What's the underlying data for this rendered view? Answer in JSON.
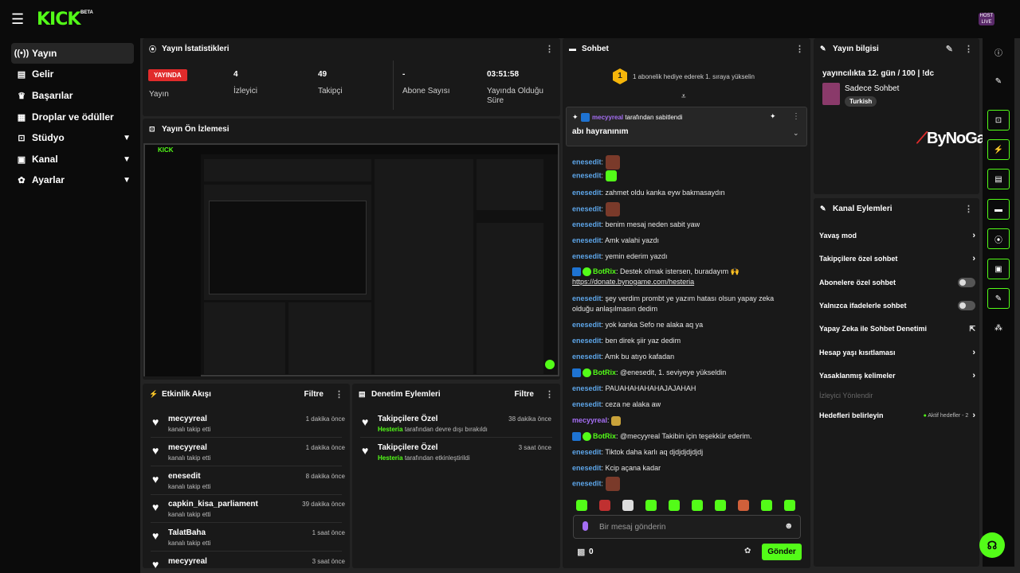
{
  "header": {
    "logo": "KICK",
    "beta": "BETA",
    "avatar_text": "HOST LIVE"
  },
  "sidebar": {
    "items": [
      {
        "label": "Yayın",
        "icon": "broadcast-icon",
        "active": true
      },
      {
        "label": "Gelir",
        "icon": "revenue-icon"
      },
      {
        "label": "Başarılar",
        "icon": "trophy-icon"
      },
      {
        "label": "Droplar ve ödüller",
        "icon": "gift-icon"
      },
      {
        "label": "Stüdyo",
        "icon": "studio-icon",
        "chevron": true
      },
      {
        "label": "Kanal",
        "icon": "channel-icon",
        "chevron": true
      },
      {
        "label": "Ayarlar",
        "icon": "gear-icon",
        "chevron": true
      }
    ]
  },
  "stats": {
    "title": "Yayın İstatistikleri",
    "live": "YAYINDA",
    "status_label": "Yayın",
    "items": [
      {
        "value": "4",
        "label": "İzleyici"
      },
      {
        "value": "49",
        "label": "Takipçi"
      },
      {
        "value": "-",
        "label": "Abone Sayısı"
      },
      {
        "value": "03:51:58",
        "label": "Yayında Olduğu Süre"
      }
    ]
  },
  "preview": {
    "title": "Yayın Ön İzlemesi"
  },
  "activity": {
    "title": "Etkinlik Akışı",
    "filter": "Filtre",
    "items": [
      {
        "name": "mecyyreal",
        "sub": "kanalı takip etti",
        "time": "1 dakika önce"
      },
      {
        "name": "mecyyreal",
        "sub": "kanalı takip etti",
        "time": "1 dakika önce"
      },
      {
        "name": "enesedit",
        "sub": "kanalı takip etti",
        "time": "8 dakika önce"
      },
      {
        "name": "capkin_kisa_parliament",
        "sub": "kanalı takip etti",
        "time": "39 dakika önce"
      },
      {
        "name": "TalatBaha",
        "sub": "kanalı takip etti",
        "time": "1 saat önce"
      },
      {
        "name": "mecyyreal",
        "sub": "",
        "time": "3 saat önce"
      }
    ]
  },
  "moderation": {
    "title": "Denetim Eylemleri",
    "filter": "Filtre",
    "items": [
      {
        "name": "Takipçilere Özel",
        "actor": "Hesteria",
        "rest": "tarafından devre dışı bırakıldı",
        "time": "38 dakika önce"
      },
      {
        "name": "Takipçilere Özel",
        "actor": "Hesteria",
        "rest": "tarafından etkinleştirildi",
        "time": "3 saat önce"
      }
    ]
  },
  "chat": {
    "title": "Sohbet",
    "gift_count": "1",
    "gift_text": "1 abonelik hediye ederek 1. sıraya yükselin",
    "pinned_user": "mecyyreal",
    "pinned_by": "tarafından sabitlendi",
    "pinned_msg": "abı hayranınım",
    "messages": [
      {
        "user": "enesedit",
        "text": "",
        "emote": "red"
      },
      {
        "user": "enesedit",
        "text": "",
        "emote": "grn"
      },
      {
        "user": "enesedit",
        "text": "zahmet oldu kanka eyw bakmasaydın"
      },
      {
        "user": "enesedit",
        "text": "",
        "emote": "red"
      },
      {
        "user": "enesedit",
        "text": "benim mesaj neden sabit yaw"
      },
      {
        "user": "enesedit",
        "text": "Amk valahi yazdı"
      },
      {
        "user": "enesedit",
        "text": "yemin ederim yazdı"
      },
      {
        "user": "BotRix",
        "bot": true,
        "text": "Destek olmak istersen, buradayım 🙌 ",
        "link": "https://donate.bynogame.com/hesteria"
      },
      {
        "user": "enesedit",
        "text": "şey verdim prombt ye yazım hatası olsun yapay zeka olduğu anlaşılmasın dedim"
      },
      {
        "user": "enesedit",
        "text": "yok kanka Sefo ne alaka aq ya"
      },
      {
        "user": "enesedit",
        "text": "ben direk şiir yaz dedim"
      },
      {
        "user": "enesedit",
        "text": "Amk bu atıyo kafadan"
      },
      {
        "user": "BotRix",
        "bot": true,
        "text": "@enesedit, 1. seviyeye yükseldin"
      },
      {
        "user": "enesedit",
        "text": "PAUAHAHAHAHAJAJAHAH"
      },
      {
        "user": "enesedit",
        "text": "ceza ne alaka aw"
      },
      {
        "user": "mecyyreal",
        "purple": true,
        "text": "",
        "emote": "yel"
      },
      {
        "user": "BotRix",
        "bot": true,
        "text": "@mecyyreal Takibin için teşekkür ederim."
      },
      {
        "user": "enesedit",
        "text": "Tiktok daha karlı aq djdjdjdjdjdj"
      },
      {
        "user": "enesedit",
        "text": "Kcip açana kadar"
      },
      {
        "user": "enesedit",
        "text": "",
        "emote": "red"
      }
    ],
    "input_placeholder": "Bir mesaj gönderin",
    "points": "0",
    "send": "Gönder"
  },
  "stream_info": {
    "title": "Yayın bilgisi",
    "stream_title": "yayıncılıkta 12. gün / 100 | !dc",
    "category": "Sadece Sohbet",
    "tag": "Turkish",
    "watermark": "ByNoGame"
  },
  "channel_actions": {
    "title": "Kanal Eylemleri",
    "items": [
      {
        "label": "Yavaş mod",
        "type": "chevron"
      },
      {
        "label": "Takipçilere özel sohbet",
        "type": "chevron"
      },
      {
        "label": "Abonelere özel sohbet",
        "type": "toggle"
      },
      {
        "label": "Yalnızca ifadelerle sohbet",
        "type": "toggle"
      },
      {
        "label": "Yapay Zeka ile Sohbet Denetimi",
        "type": "external"
      },
      {
        "label": "Hesap yaşı kısıtlaması",
        "type": "chevron"
      },
      {
        "label": "Yasaklanmış kelimeler",
        "type": "chevron"
      },
      {
        "label": "İzleyici Yönlendir",
        "type": "disabled"
      },
      {
        "label": "Hedefleri belirleyin",
        "type": "goal",
        "extra": "Aktif hedefler - 2"
      }
    ]
  },
  "colors": {
    "accent": "#53fc18",
    "live": "#e12b2b",
    "user": "#5da5e8",
    "purple": "#a56ef4"
  }
}
